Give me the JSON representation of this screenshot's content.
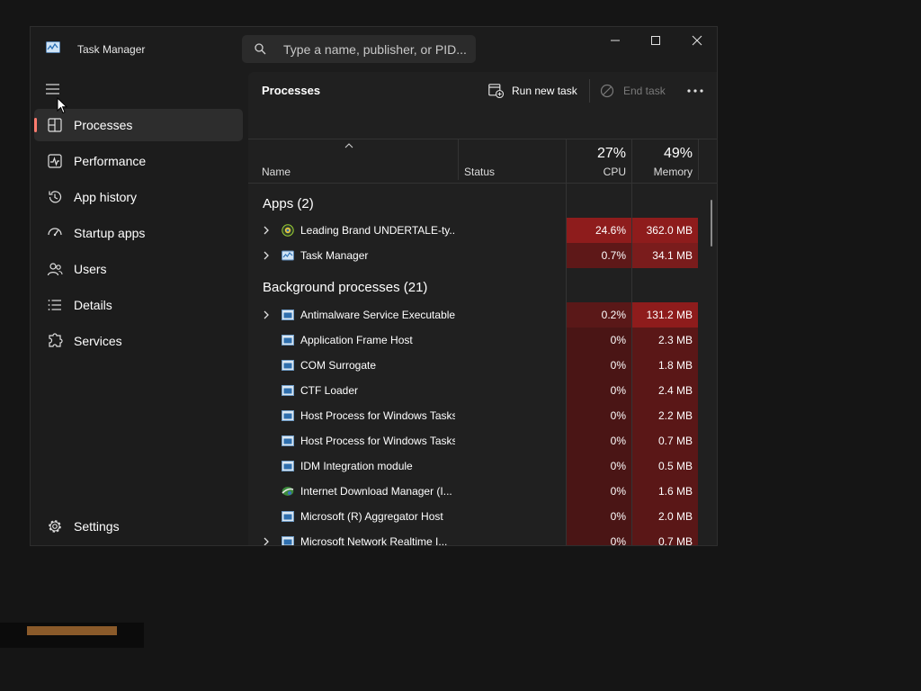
{
  "window": {
    "title": "Task Manager"
  },
  "search": {
    "placeholder": "Type a name, publisher, or PID..."
  },
  "sidebar": {
    "items": [
      {
        "label": "Processes",
        "icon": "processes-icon",
        "active": true
      },
      {
        "label": "Performance",
        "icon": "performance-icon"
      },
      {
        "label": "App history",
        "icon": "app-history-icon"
      },
      {
        "label": "Startup apps",
        "icon": "startup-apps-icon"
      },
      {
        "label": "Users",
        "icon": "users-icon"
      },
      {
        "label": "Details",
        "icon": "details-icon"
      },
      {
        "label": "Services",
        "icon": "services-icon"
      }
    ],
    "settings_label": "Settings"
  },
  "toolbar": {
    "page_title": "Processes",
    "run_new_task": "Run new task",
    "end_task": "End task"
  },
  "columns": {
    "name": "Name",
    "status": "Status",
    "cpu_percent": "27%",
    "cpu_label": "CPU",
    "memory_percent": "49%",
    "memory_label": "Memory"
  },
  "groups": {
    "apps": "Apps (2)",
    "background": "Background processes (21)"
  },
  "apps": [
    {
      "name": "Leading Brand UNDERTALE-ty...",
      "cpu": "24.6%",
      "memory": "362.0 MB",
      "expandable": true,
      "icon": "game-icon"
    },
    {
      "name": "Task Manager",
      "cpu": "0.7%",
      "memory": "34.1 MB",
      "expandable": true,
      "icon": "task-manager-icon"
    }
  ],
  "background": [
    {
      "name": "Antimalware Service Executable",
      "cpu": "0.2%",
      "memory": "131.2 MB",
      "expandable": true,
      "icon": "process-icon"
    },
    {
      "name": "Application Frame Host",
      "cpu": "0%",
      "memory": "2.3 MB",
      "expandable": false,
      "icon": "process-icon"
    },
    {
      "name": "COM Surrogate",
      "cpu": "0%",
      "memory": "1.8 MB",
      "expandable": false,
      "icon": "process-icon"
    },
    {
      "name": "CTF Loader",
      "cpu": "0%",
      "memory": "2.4 MB",
      "expandable": false,
      "icon": "process-icon"
    },
    {
      "name": "Host Process for Windows Tasks",
      "cpu": "0%",
      "memory": "2.2 MB",
      "expandable": false,
      "icon": "process-icon"
    },
    {
      "name": "Host Process for Windows Tasks",
      "cpu": "0%",
      "memory": "0.7 MB",
      "expandable": false,
      "icon": "process-icon"
    },
    {
      "name": "IDM Integration module",
      "cpu": "0%",
      "memory": "0.5 MB",
      "expandable": false,
      "icon": "process-icon"
    },
    {
      "name": "Internet Download Manager (I...",
      "cpu": "0%",
      "memory": "1.6 MB",
      "expandable": false,
      "icon": "idm-icon"
    },
    {
      "name": "Microsoft (R) Aggregator Host",
      "cpu": "0%",
      "memory": "2.0 MB",
      "expandable": false,
      "icon": "process-icon"
    },
    {
      "name": "Microsoft Network Realtime I...",
      "cpu": "0%",
      "memory": "0.7 MB",
      "expandable": true,
      "icon": "process-icon"
    }
  ],
  "colors": {
    "accent": "#ff7c6f",
    "heat_high": "#8e1c1c",
    "heat_mid": "#6e1a1a",
    "heat_low": "#4a1515"
  }
}
